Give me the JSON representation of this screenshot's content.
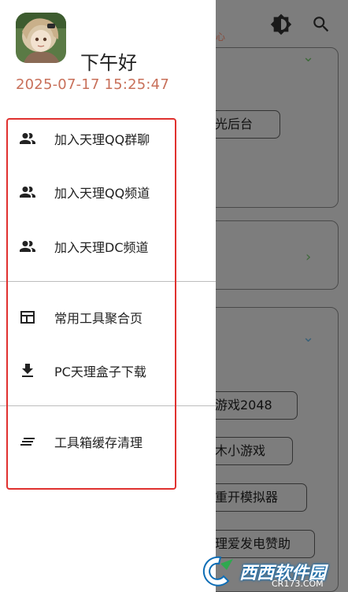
{
  "drawer": {
    "greeting": "下午好",
    "datetime": "2025-07-17 15:25:47",
    "group1": [
      {
        "label": "加入天理QQ群聊",
        "icon": "people-icon"
      },
      {
        "label": "加入天理QQ频道",
        "icon": "people-icon"
      },
      {
        "label": "加入天理DC频道",
        "icon": "people-icon"
      }
    ],
    "group2": [
      {
        "label": "常用工具聚合页",
        "icon": "dashboard-icon"
      },
      {
        "label": "PC天理盒子下载",
        "icon": "download-icon"
      }
    ],
    "group3": [
      {
        "label": "工具箱缓存清理",
        "icon": "clear-all-icon"
      }
    ]
  },
  "background": {
    "top_hint": "心",
    "buttons": [
      "光后台",
      "游戏2048",
      "木小游戏",
      "重开模拟器",
      "理爱发电赞助"
    ]
  },
  "watermark": {
    "text": "西西软件园",
    "sub": "CR173.COM"
  },
  "colors": {
    "accent_datetime": "#c8705a",
    "highlight_box": "#e0312f",
    "dim_overlay": "#7d7d7d"
  }
}
